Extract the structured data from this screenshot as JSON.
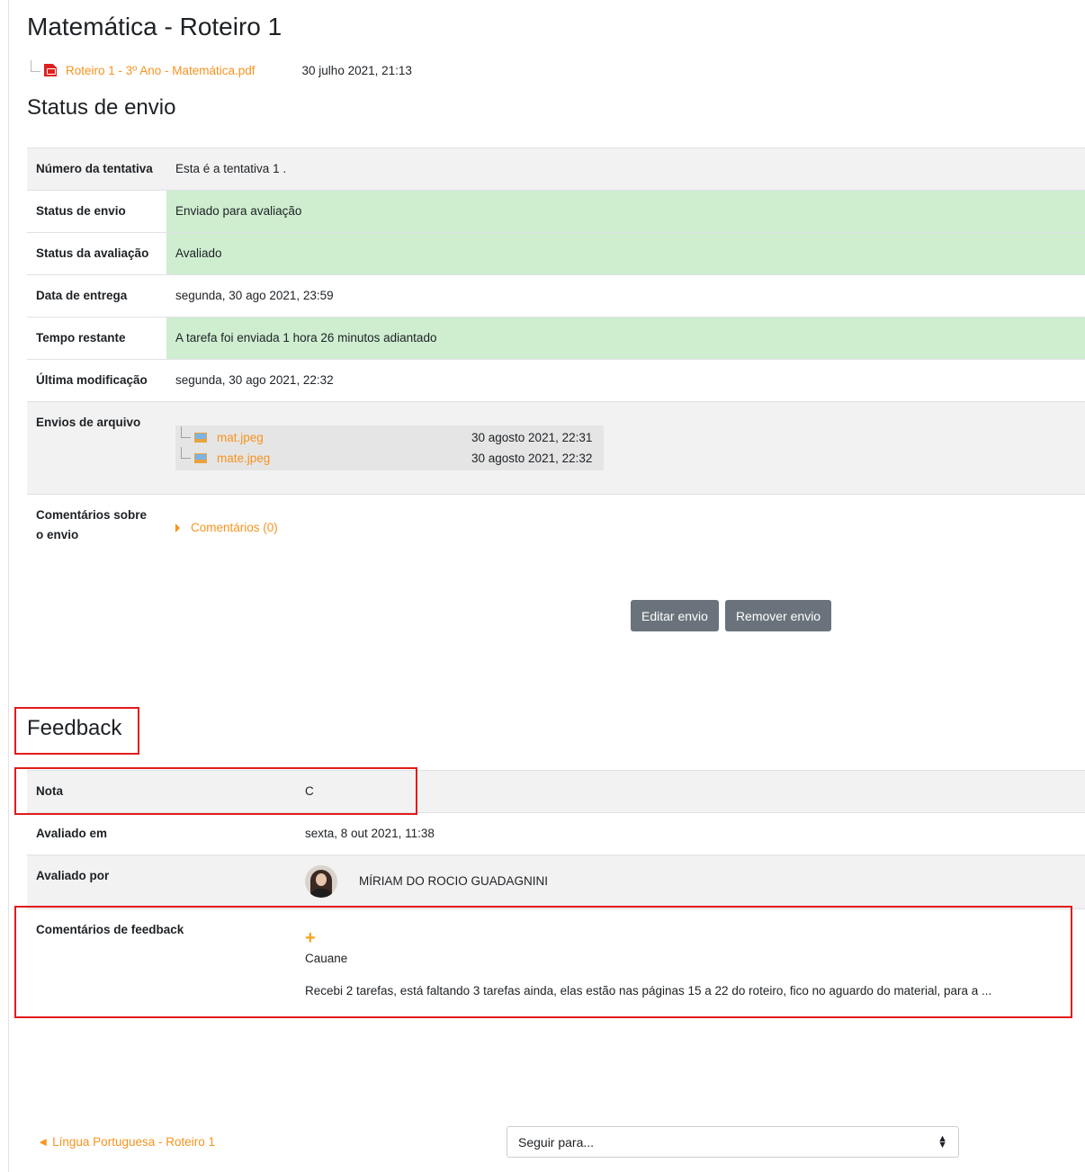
{
  "page": {
    "title": "Matemática - Roteiro 1",
    "intro_file": {
      "name": "Roteiro 1 - 3º Ano - Matemática.pdf",
      "date": "30 julho 2021, 21:13"
    }
  },
  "submission": {
    "heading": "Status de envio",
    "attempt_label": "Número da tentativa",
    "attempt_value": "Esta é a tentativa 1 .",
    "status_label": "Status de envio",
    "status_value": "Enviado para avaliação",
    "grading_label": "Status da avaliação",
    "grading_value": "Avaliado",
    "due_label": "Data de entrega",
    "due_value": "segunda, 30 ago 2021, 23:59",
    "time_label": "Tempo restante",
    "time_value": "A tarefa foi enviada 1 hora 26 minutos adiantado",
    "modified_label": "Última modificação",
    "modified_value": "segunda, 30 ago 2021, 22:32",
    "files_label": "Envios de arquivo",
    "files": [
      {
        "name": "mat.jpeg",
        "date": "30 agosto 2021, 22:31"
      },
      {
        "name": "mate.jpeg",
        "date": "30 agosto 2021, 22:32"
      }
    ],
    "comments_label": "Comentários sobre o envio",
    "comments_link": "Comentários (0)"
  },
  "actions": {
    "edit": "Editar envio",
    "remove": "Remover envio"
  },
  "feedback": {
    "heading": "Feedback",
    "grade_label": "Nota",
    "grade_value": "C",
    "graded_on_label": "Avaliado em",
    "graded_on_value": "sexta, 8 out 2021, 11:38",
    "graded_by_label": "Avaliado por",
    "grader_name": "MÍRIAM DO ROCIO GUADAGNINI",
    "comments_label": "Comentários de feedback",
    "comment_author": "Cauane",
    "comment_text": "Recebi 2 tarefas, está faltando 3 tarefas ainda,  elas estão nas páginas 15 a 22 do roteiro, fico no aguardo do material, para a ..."
  },
  "navigation": {
    "prev_link": "Língua Portuguesa - Roteiro 1",
    "jump_placeholder": "Seguir para..."
  },
  "colors": {
    "link": "#f7931e",
    "success_bg": "#cfeed0",
    "highlight": "#e31b1b",
    "button": "#6a737b"
  }
}
